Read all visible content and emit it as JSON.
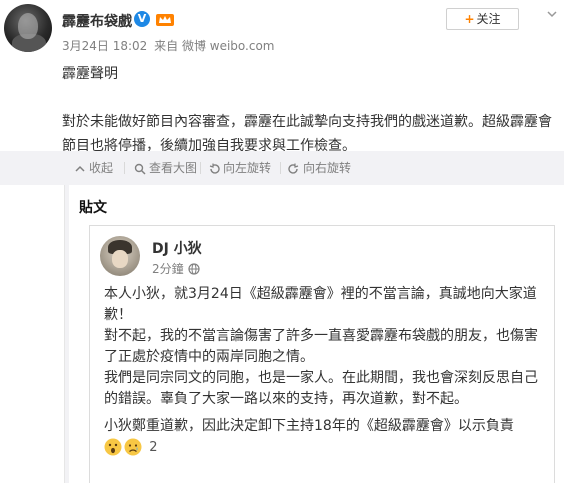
{
  "post": {
    "username": "霹靂布袋戲",
    "date": "3月24日 18:02",
    "source": "来自 微博 weibo.com",
    "follow_label": "关注",
    "title": "霹靂聲明",
    "body": "對於未能做好節目內容審查，霹靂在此誠摯向支持我們的戲迷道歉。超級霹靂會節目也將停播，後續加強自我要求與工作檢查。"
  },
  "toolbar": {
    "collapse": "收起",
    "view_large": "查看大图",
    "rotate_left": "向左旋转",
    "rotate_right": "向右旋转"
  },
  "repost": {
    "heading": "貼文",
    "author": "DJ 小狄",
    "time": "2分鐘",
    "lines": [
      "本人小狄，就3月24日《超級霹靂會》裡的不當言論，真誠地向大家道歉！",
      "對不起，我的不當言論傷害了許多一直喜愛霹靂布袋戲的朋友，也傷害了正處於疫情中的兩岸同胞之情。",
      "我們是同宗同文的同胞，也是一家人。在此期間，我也會深刻反思自己的錯誤。辜負了大家一路以來的支持，再次道歉，對不起。"
    ],
    "last_line": "小狄鄭重道歉，因此決定卸下主持18年的《超級霹靂會》以示負責",
    "reaction_count": "2"
  },
  "colors": {
    "accent_orange": "#ff8200",
    "verified_blue": "#1e88e5",
    "muted_text": "#808080",
    "toolbar_bg": "#f2f2f5"
  }
}
